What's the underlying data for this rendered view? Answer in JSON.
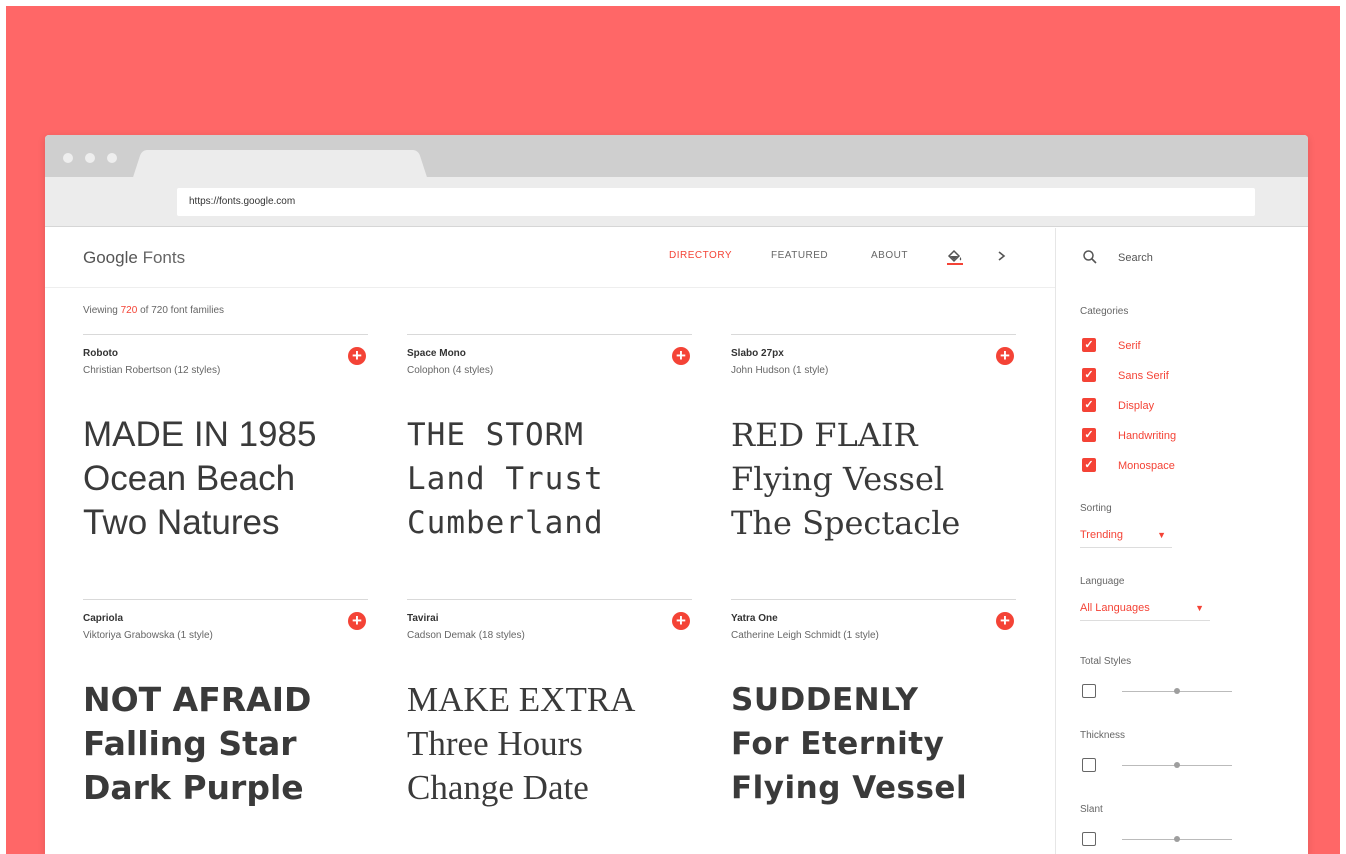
{
  "colors": {
    "backdrop": "#ff6767",
    "accent": "#f44336"
  },
  "browser": {
    "url": "https://fonts.google.com"
  },
  "header": {
    "logo_google": "Google",
    "logo_fonts": "Fonts",
    "nav": [
      "DIRECTORY",
      "FEATURED",
      "ABOUT"
    ],
    "active_nav": "DIRECTORY",
    "icons": [
      "paint-bucket-icon",
      "chevron-right-icon"
    ]
  },
  "main": {
    "viewing_prefix": "Viewing",
    "viewing_count": "720",
    "viewing_suffix": "of 720 font families",
    "fonts": [
      {
        "name": "Roboto",
        "author": "Christian Robertson (12 styles)",
        "sample": [
          "MADE IN 1985",
          "Ocean Beach",
          "Two Natures"
        ]
      },
      {
        "name": "Space Mono",
        "author": "Colophon (4 styles)",
        "sample": [
          "THE STORM",
          "Land Trust",
          "Cumberland"
        ]
      },
      {
        "name": "Slabo 27px",
        "author": "John Hudson (1 style)",
        "sample": [
          "RED FLAIR",
          "Flying Vessel",
          "The Spectacle"
        ]
      },
      {
        "name": "Capriola",
        "author": "Viktoriya Grabowska (1 style)",
        "sample": [
          "NOT AFRAID",
          "Falling Star",
          "Dark Purple"
        ]
      },
      {
        "name": "Tavirai",
        "author": "Cadson Demak (18 styles)",
        "sample": [
          "MAKE EXTRA",
          "Three Hours",
          "Change Date"
        ]
      },
      {
        "name": "Yatra One",
        "author": "Catherine Leigh Schmidt (1 style)",
        "sample": [
          "SUDDENLY",
          "For Eternity",
          "Flying Vessel"
        ]
      }
    ]
  },
  "sidebar": {
    "search_placeholder": "Search",
    "categories_label": "Categories",
    "categories": [
      "Serif",
      "Sans Serif",
      "Display",
      "Handwriting",
      "Monospace"
    ],
    "sorting_label": "Sorting",
    "sorting_value": "Trending",
    "language_label": "Language",
    "language_value": "All Languages",
    "total_styles_label": "Total Styles",
    "thickness_label": "Thickness",
    "slant_label": "Slant"
  }
}
